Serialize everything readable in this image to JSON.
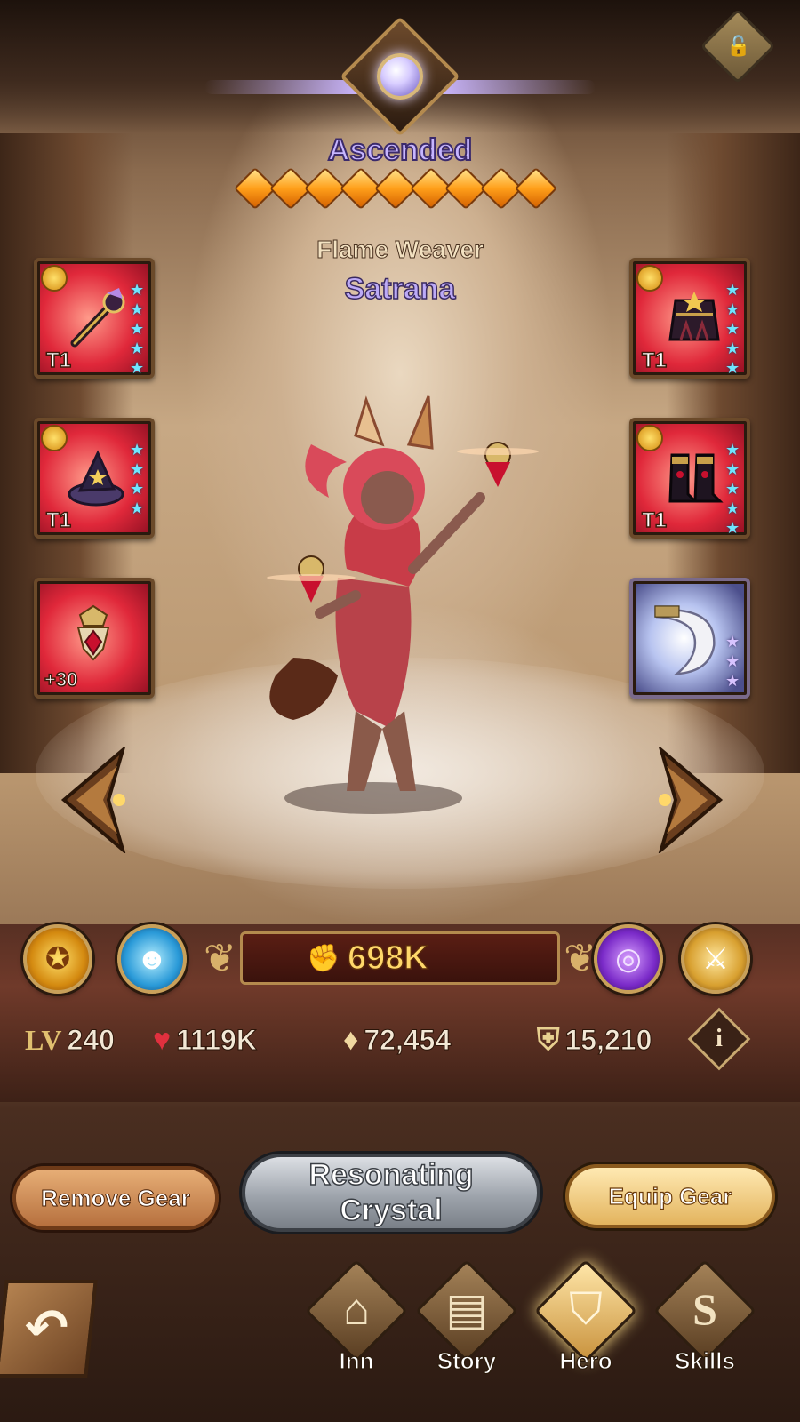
{
  "hero": {
    "ascension": "Ascended",
    "stars_count": 9,
    "title": "Flame Weaver",
    "name": "Satrana"
  },
  "gear": {
    "left": [
      {
        "slot": "weapon",
        "tier": "T1",
        "stars": 5,
        "icon": "staff-icon"
      },
      {
        "slot": "head",
        "tier": "T1",
        "stars": 4,
        "icon": "witch-hat-icon"
      },
      {
        "slot": "signature",
        "level": "+30",
        "icon": "amulet-icon"
      }
    ],
    "right": [
      {
        "slot": "armor",
        "tier": "T1",
        "stars": 5,
        "icon": "robe-icon"
      },
      {
        "slot": "boots",
        "tier": "T1",
        "stars": 5,
        "icon": "boots-icon"
      },
      {
        "slot": "furniture",
        "stars": 3,
        "icon": "horn-icon"
      }
    ]
  },
  "stats": {
    "power": "698K",
    "level_label": "LV",
    "level": "240",
    "hp": "1119K",
    "attack": "72,454",
    "defense": "15,210"
  },
  "actions": {
    "remove_gear": "Remove Gear",
    "crystal_line1": "Resonating",
    "crystal_line2": "Crystal",
    "equip_gear": "Equip Gear"
  },
  "nav": {
    "inn": "Inn",
    "story": "Story",
    "hero": "Hero",
    "skills": "Skills"
  },
  "colors": {
    "ascended_text": "#c7b6ff",
    "power_text": "#ffd86a",
    "tier_star": "#6fe6ff"
  }
}
